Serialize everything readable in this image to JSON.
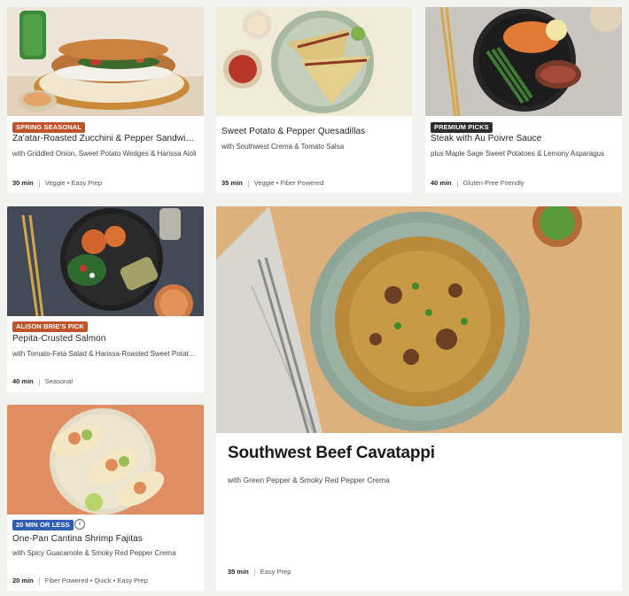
{
  "cards": [
    {
      "badge": "SPRING SEASONAL",
      "badge_color": "#c0532a",
      "title": "Za'atar-Roasted Zucchini & Pepper Sandwiches",
      "subtitle": "with Griddled Onion, Sweet Potato Wedges & Harissa Aioli",
      "time": "30 min",
      "tags": "Veggie • Easy Prep"
    },
    {
      "badge": "",
      "title": "Sweet Potato & Pepper Quesadillas",
      "subtitle": "with Southwest Crema & Tomato Salsa",
      "time": "35 min",
      "tags": "Veggie • Fiber Powered"
    },
    {
      "badge": "PREMIUM PICKS",
      "badge_color": "#2b2b2b",
      "title": "Steak with Au Poivre Sauce",
      "subtitle": "plus Maple Sage Sweet Potatoes & Lemony Asparagus",
      "time": "40 min",
      "tags": "Gluten-Free Friendly"
    },
    {
      "badge": "ALISON BRIE'S PICK",
      "badge_color": "#c0532a",
      "title": "Pepita-Crusted Salmon",
      "subtitle": "with Tomato-Feta Salad & Harissa-Roasted Sweet Potatoes",
      "time": "40 min",
      "tags": "Seasonal"
    },
    {
      "badge": "",
      "title": "Southwest Beef Cavatappi",
      "subtitle": "with Green Pepper & Smoky Red Pepper Crema",
      "time": "35 min",
      "tags": "Easy Prep"
    },
    {
      "badge": "20 MIN OR LESS",
      "badge_color": "#2f5fb3",
      "title": "One-Pan Cantina Shrimp Fajitas",
      "subtitle": "with Spicy Guacamole & Smoky Red Pepper Crema",
      "time": "20 min",
      "tags": "Fiber Powered • Quick • Easy Prep"
    }
  ],
  "icons": {
    "info": "info-icon"
  }
}
